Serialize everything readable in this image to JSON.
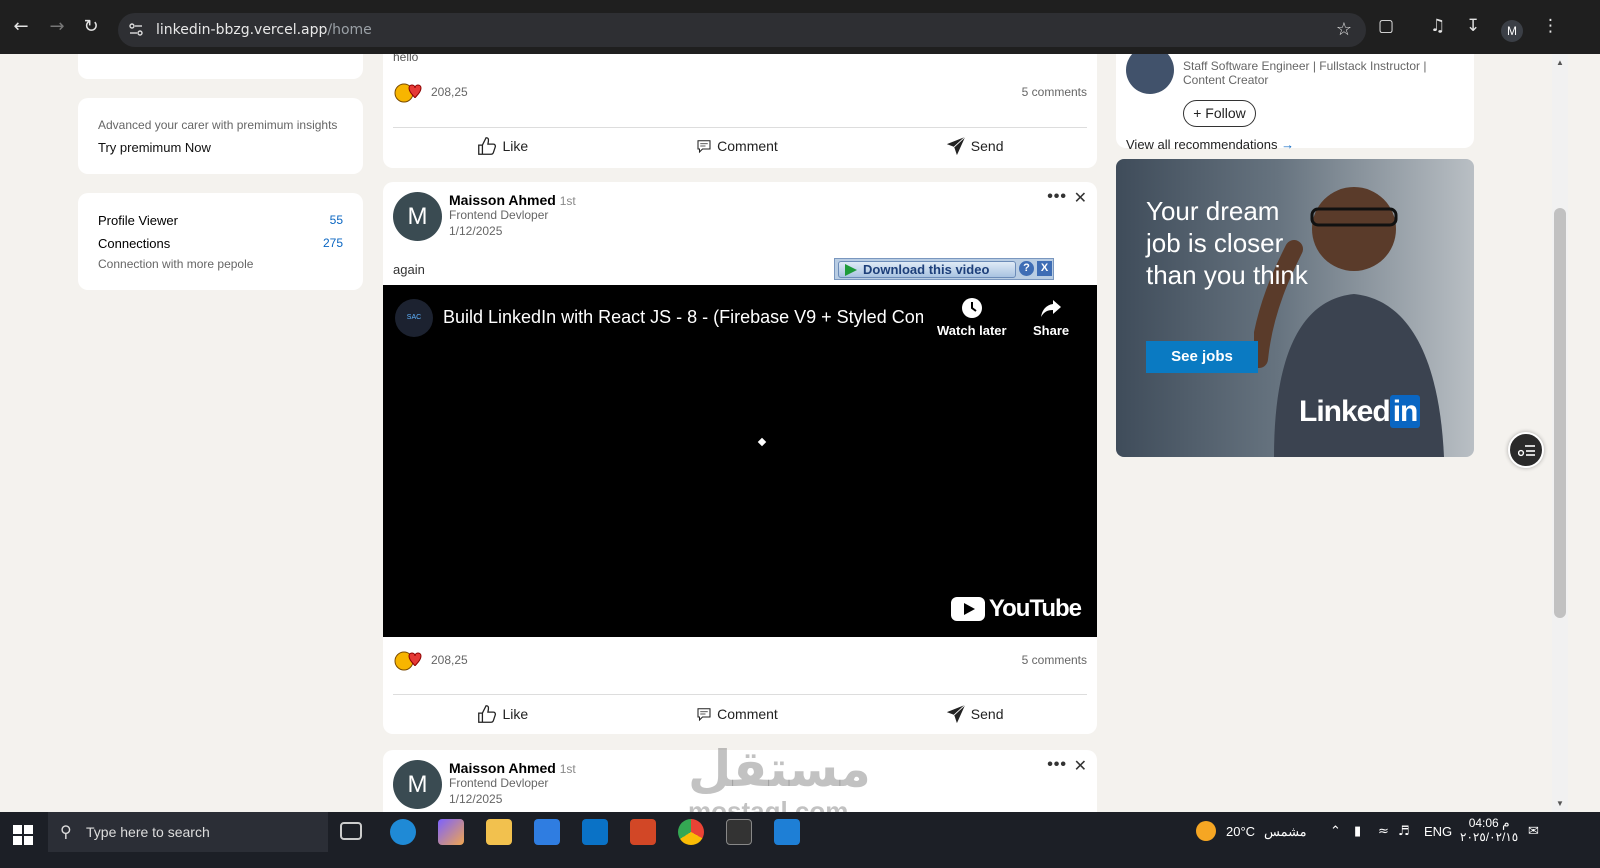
{
  "browser": {
    "url_host": "linkedin-bbzg.vercel.app",
    "url_path": "/home",
    "profile_initial": "M"
  },
  "left": {
    "premium": {
      "muted": "Advanced your carer with premimum insights",
      "link": "Try premimum Now"
    },
    "stats": {
      "profile_viewer_label": "Profile Viewer",
      "profile_viewer_value": "55",
      "connections_label": "Connections",
      "connections_value": "275",
      "connect_more": "Connection with more pepole"
    }
  },
  "feed": {
    "post1": {
      "text_fragment": "hello",
      "reaction_count": "208,25",
      "comments": "5 comments"
    },
    "post2": {
      "avatar_initial": "M",
      "author": "Maisson Ahmed",
      "degree": "1st",
      "headline": "Frontend Devloper",
      "date": "1/12/2025",
      "description": "again",
      "video": {
        "channel_logo": "SAC",
        "title": "Build LinkedIn with React JS - 8 - (Firebase V9 + Styled Com...",
        "watch_later": "Watch later",
        "share": "Share",
        "brand": "YouTube"
      },
      "download_bar": {
        "label": "Download this video",
        "help": "?",
        "close": "X"
      },
      "reaction_count": "208,25",
      "comments": "5 comments"
    },
    "post3": {
      "avatar_initial": "M",
      "author": "Maisson Ahmed",
      "degree": "1st",
      "headline": "Frontend Devloper",
      "date": "1/12/2025"
    },
    "actions": {
      "like": "Like",
      "comment": "Comment",
      "send": "Send"
    }
  },
  "right": {
    "recommendation": {
      "headline": "Staff Software Engineer | Fullstack Instructor | Content Creator",
      "follow": "Follow",
      "view_all": "View all recommendations"
    },
    "ad": {
      "headline": "Your dream job is closer than you think",
      "cta": "See jobs",
      "brand_linked": "Linked",
      "brand_in": "in"
    }
  },
  "watermark": {
    "arabic": "مستقل",
    "latin": "mostaql.com"
  },
  "taskbar": {
    "search_placeholder": "Type here to search",
    "weather": "20°C",
    "weather_desc": "مشمس",
    "lang": "ENG",
    "time": "04:06 م",
    "date": "٢٠٢٥/٠٢/١٥"
  }
}
